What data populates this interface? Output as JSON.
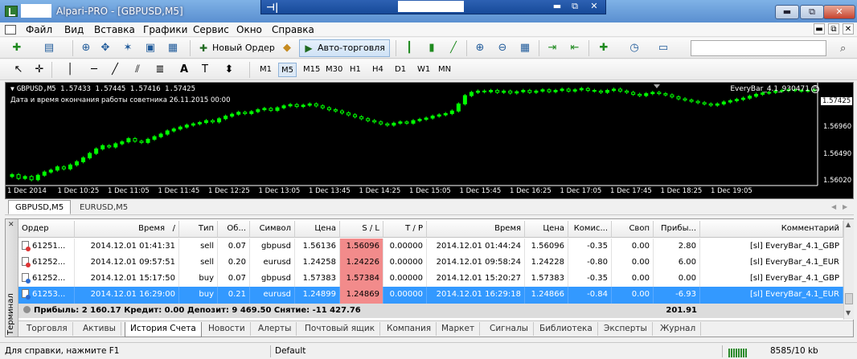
{
  "window": {
    "title": "Alpari-PRO - [GBPUSD,M5]",
    "remote_pin": "⊣|",
    "controls": {
      "minimize": "▬",
      "restore": "⧉",
      "close": "✕"
    }
  },
  "menu": [
    "Файл",
    "Вид",
    "Вставка",
    "Графики",
    "Сервис",
    "Окно",
    "Справка"
  ],
  "toolbar": {
    "new_order": "Новый Ордер",
    "auto_trading": "Авто-торговля"
  },
  "timeframes": [
    "M1",
    "M5",
    "M15",
    "M30",
    "H1",
    "H4",
    "D1",
    "W1",
    "MN"
  ],
  "active_timeframe": "M5",
  "chart": {
    "header": "GBPUSD,M5  1.57433 1.57445 1.57416 1.57425",
    "note": "Дата и время окончания работы советника 26.11.2015 00:00",
    "expert": "EveryBar_4.1_930471",
    "expert_icon": "☺",
    "current_price": "1.57425",
    "colors": {
      "background": "#000000",
      "bull": "#00ff00",
      "bear": "#000000",
      "wick": "#00ff00"
    }
  },
  "chart_data": {
    "type": "candlestick",
    "symbol": "GBPUSD",
    "timeframe": "M5",
    "price_ticks": [
      "1.57425",
      "1.56960",
      "1.56490",
      "1.56020"
    ],
    "time_ticks": [
      "1 Dec 2014",
      "1 Dec 10:25",
      "1 Dec 11:05",
      "1 Dec 11:45",
      "1 Dec 12:25",
      "1 Dec 13:05",
      "1 Dec 13:45",
      "1 Dec 14:25",
      "1 Dec 15:05",
      "1 Dec 15:45",
      "1 Dec 16:25",
      "1 Dec 17:05",
      "1 Dec 17:45",
      "1 Dec 18:25",
      "1 Dec 19:05"
    ],
    "ylim": [
      1.5595,
      1.5755
    ],
    "close_series": [
      1.5612,
      1.5606,
      1.5609,
      1.5604,
      1.5611,
      1.5616,
      1.5619,
      1.5624,
      1.5621,
      1.5627,
      1.5632,
      1.5638,
      1.5645,
      1.5652,
      1.5657,
      1.5655,
      1.566,
      1.5663,
      1.5668,
      1.5664,
      1.5662,
      1.5667,
      1.5671,
      1.5675,
      1.568,
      1.5683,
      1.5686,
      1.5689,
      1.5691,
      1.5693,
      1.5696,
      1.5694,
      1.5699,
      1.5703,
      1.5706,
      1.5709,
      1.5707,
      1.571,
      1.5713,
      1.5715,
      1.5712,
      1.5716,
      1.5719,
      1.5721,
      1.5718,
      1.572,
      1.5722,
      1.5719,
      1.5716,
      1.5713,
      1.5711,
      1.5708,
      1.5705,
      1.5702,
      1.5699,
      1.5696,
      1.5694,
      1.5691,
      1.5689,
      1.5692,
      1.5694,
      1.5692,
      1.5696,
      1.5698,
      1.57,
      1.5703,
      1.5705,
      1.5707,
      1.5711,
      1.5722,
      1.5735,
      1.574,
      1.5742,
      1.5741,
      1.5743,
      1.574,
      1.5742,
      1.5739,
      1.5741,
      1.5743,
      1.574,
      1.5742,
      1.5744,
      1.5741,
      1.5743,
      1.5745,
      1.5742,
      1.5744,
      1.5746,
      1.5743,
      1.5742,
      1.574,
      1.5743,
      1.5745,
      1.5742,
      1.574,
      1.5737,
      1.5735,
      1.5738,
      1.574,
      1.5738,
      1.5736,
      1.5733,
      1.573,
      1.5728,
      1.5726,
      1.5724,
      1.5722,
      1.572,
      1.5722,
      1.5725,
      1.5727,
      1.5729,
      1.5731,
      1.5734,
      1.5737,
      1.5739,
      1.574,
      1.5742,
      1.5743,
      1.5744,
      1.5743,
      1.5742,
      1.5743,
      1.5744
    ]
  },
  "chart_tabs": [
    "GBPUSD,M5",
    "EURUSD,M5"
  ],
  "terminal": {
    "side_label": "Терминал",
    "close_glyph": "✕",
    "columns": [
      "Ордер",
      "Время",
      "Тип",
      "Об...",
      "Символ",
      "Цена",
      "S / L",
      "T / P",
      "Время",
      "Цена",
      "Комис...",
      "Своп",
      "Прибы...",
      "Комментарий"
    ],
    "sort_indicator": "/",
    "rows": [
      {
        "order": "61251...",
        "open_time": "2014.12.01 01:41:31",
        "type": "sell",
        "volume": "0.07",
        "symbol": "gbpusd",
        "price": "1.56136",
        "sl": "1.56096",
        "tp": "0.00000",
        "close_time": "2014.12.01 01:44:24",
        "close_price": "1.56096",
        "commission": "-0.35",
        "swap": "0.00",
        "profit": "2.80",
        "comment": "[sl] EveryBar_4.1_GBP",
        "icon_color": "red"
      },
      {
        "order": "61252...",
        "open_time": "2014.12.01 09:57:51",
        "type": "sell",
        "volume": "0.20",
        "symbol": "eurusd",
        "price": "1.24258",
        "sl": "1.24226",
        "tp": "0.00000",
        "close_time": "2014.12.01 09:58:24",
        "close_price": "1.24228",
        "commission": "-0.80",
        "swap": "0.00",
        "profit": "6.00",
        "comment": "[sl] EveryBar_4.1_EUR",
        "icon_color": "red"
      },
      {
        "order": "61252...",
        "open_time": "2014.12.01 15:17:50",
        "type": "buy",
        "volume": "0.07",
        "symbol": "gbpusd",
        "price": "1.57383",
        "sl": "1.57384",
        "tp": "0.00000",
        "close_time": "2014.12.01 15:20:27",
        "close_price": "1.57383",
        "commission": "-0.35",
        "swap": "0.00",
        "profit": "0.00",
        "comment": "[sl] EveryBar_4.1_GBP",
        "icon_color": "blue"
      },
      {
        "order": "61253...",
        "open_time": "2014.12.01 16:29:00",
        "type": "buy",
        "volume": "0.21",
        "symbol": "eurusd",
        "price": "1.24899",
        "sl": "1.24869",
        "tp": "0.00000",
        "close_time": "2014.12.01 16:29:18",
        "close_price": "1.24866",
        "commission": "-0.84",
        "swap": "0.00",
        "profit": "-6.93",
        "comment": "[sl] EveryBar_4.1_EUR",
        "icon_color": "blue",
        "selected": true
      }
    ],
    "summary": "Прибыль: 2 160.17  Кредит: 0.00  Депозит: 9 469.50  Снятие: -11 427.76",
    "summary_profit": "201.91",
    "tabs": [
      "Торговля",
      "Активы",
      "История Счета",
      "Новости",
      "Алерты",
      "Почтовый ящик",
      "Компания",
      "Маркет",
      "Сигналы",
      "Библиотека",
      "Эксперты",
      "Журнал"
    ],
    "active_tab": "История Счета"
  },
  "status": {
    "help": "Для справки, нажмите F1",
    "profile": "Default",
    "traffic": "8585/10 kb"
  }
}
